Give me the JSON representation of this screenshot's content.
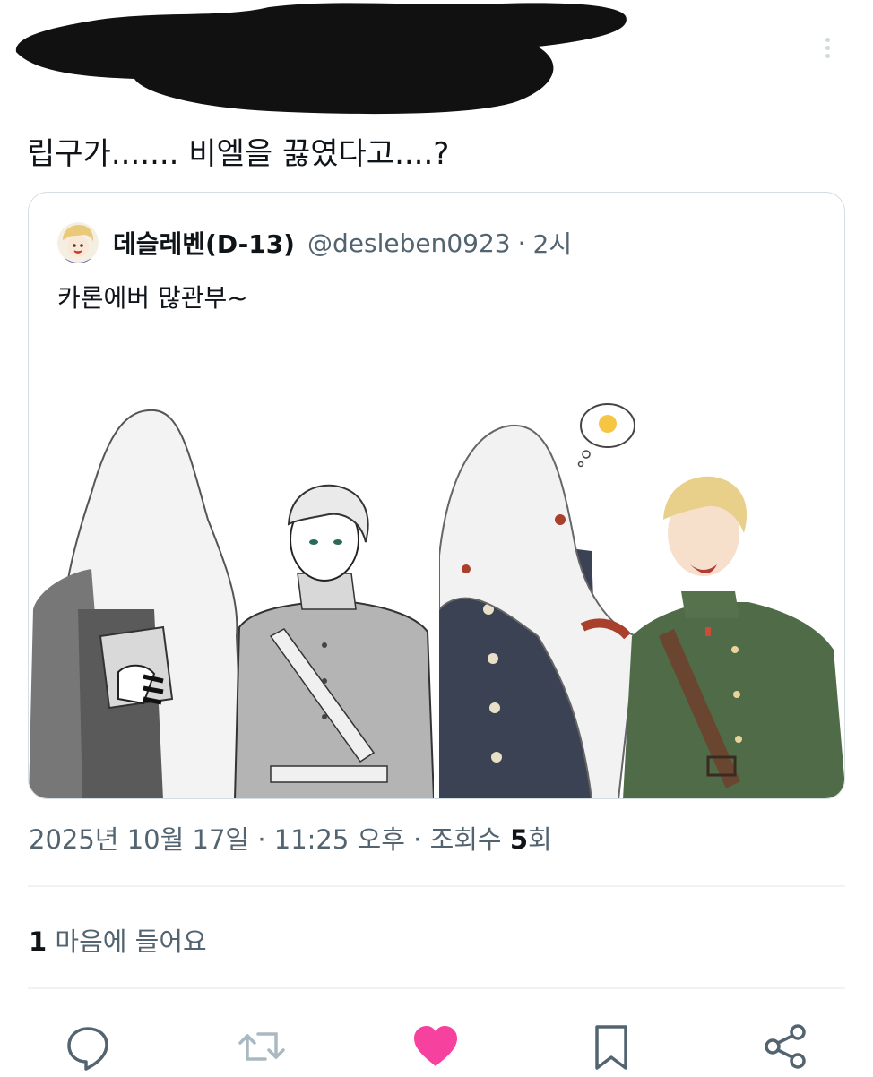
{
  "tweet": {
    "text": "립구가....... 비엘을 끓였다고....?"
  },
  "quoted": {
    "name": "데슬레벤(D-13)",
    "handle": "@desleben0923",
    "separator": "·",
    "time": "2시",
    "text": "카론에버 많관부~",
    "images": [
      {
        "description_icon": "illustration-left"
      },
      {
        "description_icon": "illustration-right"
      }
    ]
  },
  "meta": {
    "date": "2025년 10월 17일",
    "sep1": "·",
    "time": "11:25 오후",
    "sep2": "·",
    "views_label": "조회수",
    "views_count": "5",
    "views_suffix": "회"
  },
  "engagement": {
    "likes_count": "1",
    "likes_label": "마음에 들어요"
  },
  "actions": {
    "reply_icon": "reply-icon",
    "retweet_icon": "retweet-icon",
    "like_icon": "heart-icon",
    "bookmark_icon": "bookmark-icon",
    "share_icon": "share-icon"
  },
  "colors": {
    "like": "#f6419e",
    "muted": "#536471",
    "border": "#d4dde2"
  }
}
